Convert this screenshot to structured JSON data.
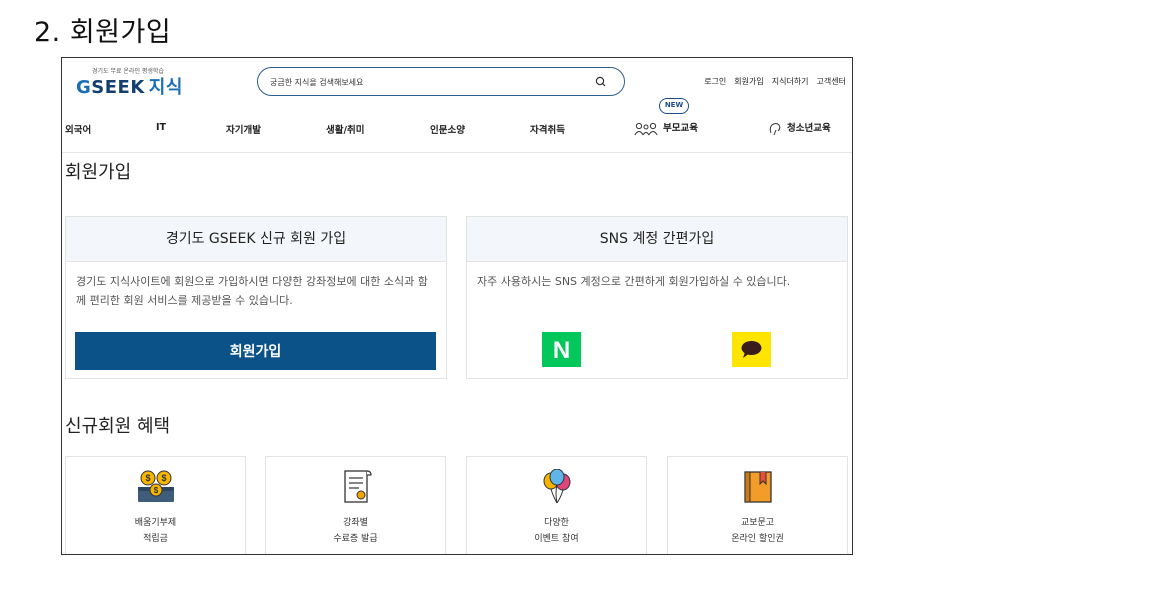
{
  "doc_heading": "2.  회원가입",
  "header": {
    "logo_small": "경기도 무료 온라인 평생학습",
    "logo_brand_g": "G",
    "logo_brand_rest": "SEEK",
    "logo_brand_ko": "지식",
    "search_placeholder": "궁금한 지식을 검색해보세요",
    "util": [
      "로그인",
      "회원가입",
      "지식더하기",
      "고객센터"
    ]
  },
  "gnb": {
    "items": [
      "외국어",
      "IT",
      "자기개발",
      "생활/취미",
      "인문소양",
      "자격취득",
      "부모교육",
      "청소년교육"
    ],
    "new_badge": "NEW"
  },
  "page_title": "회원가입",
  "panels": {
    "left": {
      "title": "경기도 GSEEK 신규 회원 가입",
      "desc": "경기도 지식사이트에 회원으로 가입하시면 다양한 강좌정보에 대한 소식과 함께 편리한 회원 서비스를 제공받을 수 있습니다.",
      "button": "회원가입"
    },
    "right": {
      "title": "SNS 계정 간편가입",
      "desc": "자주 사용하시는 SNS 계정으로 간편하게 회원가입하실 수 있습니다.",
      "naver_letter": "N"
    }
  },
  "benefits": {
    "title": "신규회원 혜택",
    "items": [
      {
        "line1": "배움기부제",
        "line2": "적립금",
        "icon": "coin-piggy-icon"
      },
      {
        "line1": "강좌별",
        "line2": "수료증 발급",
        "icon": "certificate-icon"
      },
      {
        "line1": "다양한",
        "line2": "이벤트 참여",
        "icon": "balloons-icon"
      },
      {
        "line1": "교보문고",
        "line2": "온라인 할인권",
        "icon": "book-icon"
      }
    ]
  },
  "colors": {
    "brand_navy": "#0b5289",
    "naver_green": "#03c75a",
    "kakao_yellow": "#fee500"
  }
}
